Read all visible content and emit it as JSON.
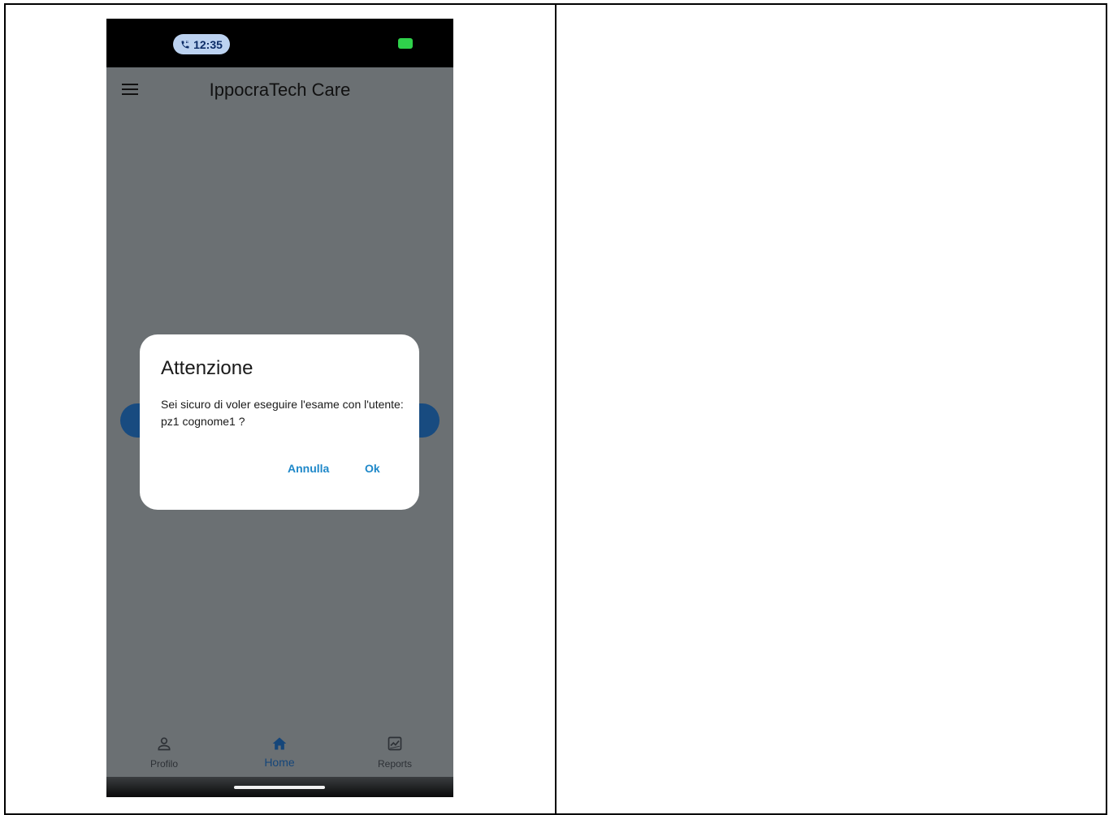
{
  "status_bar": {
    "time": "12:35",
    "call_icon": "phone-call-icon",
    "battery_color": "#2fd14b"
  },
  "app_bar": {
    "title": "IppocraTech Care",
    "menu_icon": "hamburger-menu-icon"
  },
  "dialog": {
    "title": "Attenzione",
    "message": "Sei sicuro di voler eseguire l'esame con l'utente: pz1 cognome1 ?",
    "cancel_label": "Annulla",
    "ok_label": "Ok",
    "accent_color": "#1e88c9"
  },
  "tabbar": {
    "tabs": [
      {
        "label": "Profilo",
        "icon": "user-icon",
        "selected": false
      },
      {
        "label": "Home",
        "icon": "home-icon",
        "selected": true
      },
      {
        "label": "Reports",
        "icon": "chart-icon",
        "selected": false
      }
    ],
    "selected_color": "#15467a"
  }
}
